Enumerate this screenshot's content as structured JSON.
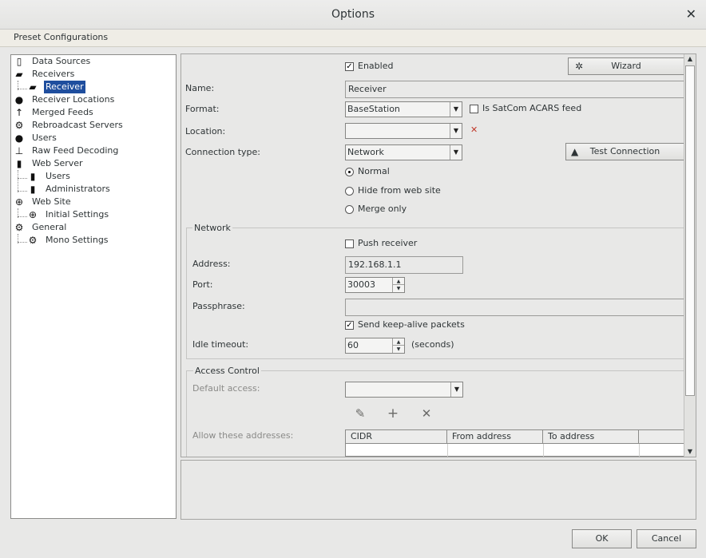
{
  "window": {
    "title": "Options",
    "close_glyph": "✕"
  },
  "preset_bar": {
    "label": "Preset Configurations"
  },
  "tree": {
    "items": [
      {
        "label": "Data Sources",
        "icon": "document-icon"
      },
      {
        "label": "Receivers",
        "icon": "radio-icon"
      },
      {
        "label": "Receiver",
        "icon": "radio-icon"
      },
      {
        "label": "Receiver Locations",
        "icon": "map-pin-icon"
      },
      {
        "label": "Merged Feeds",
        "icon": "merge-arrow-icon"
      },
      {
        "label": "Rebroadcast Servers",
        "icon": "broadcast-icon"
      },
      {
        "label": "Users",
        "icon": "user-icon"
      },
      {
        "label": "Raw Feed Decoding",
        "icon": "decoder-icon"
      },
      {
        "label": "Web Server",
        "icon": "server-icon"
      },
      {
        "label": "Users",
        "icon": "server-icon"
      },
      {
        "label": "Administrators",
        "icon": "server-icon"
      },
      {
        "label": "Web Site",
        "icon": "globe-icon"
      },
      {
        "label": "Initial Settings",
        "icon": "globe-icon"
      },
      {
        "label": "General",
        "icon": "gear-icon"
      },
      {
        "label": "Mono Settings",
        "icon": "gear-icon"
      }
    ]
  },
  "form": {
    "enabled_label": "Enabled",
    "enabled_checked": true,
    "wizard_label": "Wizard",
    "name_label": "Name:",
    "name_value": "Receiver",
    "format_label": "Format:",
    "format_value": "BaseStation",
    "satcom_label": "Is SatCom ACARS feed",
    "satcom_checked": false,
    "location_label": "Location:",
    "location_value": "",
    "clear_glyph": "✕",
    "connection_type_label": "Connection type:",
    "connection_type_value": "Network",
    "test_connection_label": "Test Connection",
    "radio_normal": "Normal",
    "radio_hide": "Hide from web site",
    "radio_merge": "Merge only",
    "selected_radio": "Normal"
  },
  "network": {
    "title": "Network",
    "push_receiver_label": "Push receiver",
    "push_receiver_checked": false,
    "address_label": "Address:",
    "address_value": "192.168.1.1",
    "port_label": "Port:",
    "port_value": "30003",
    "passphrase_label": "Passphrase:",
    "passphrase_value": "",
    "keepalive_label": "Send keep-alive packets",
    "keepalive_checked": true,
    "idle_timeout_label": "Idle timeout:",
    "idle_timeout_value": "60",
    "seconds_label": "(seconds)"
  },
  "access": {
    "title": "Access Control",
    "default_access_label": "Default access:",
    "default_access_value": "",
    "allow_label": "Allow these addresses:",
    "columns": [
      "CIDR",
      "From address",
      "To address"
    ]
  },
  "footer": {
    "ok_label": "OK",
    "cancel_label": "Cancel"
  },
  "colors": {
    "selection": "#1f4e9e",
    "clear_x": "#c0392b"
  }
}
